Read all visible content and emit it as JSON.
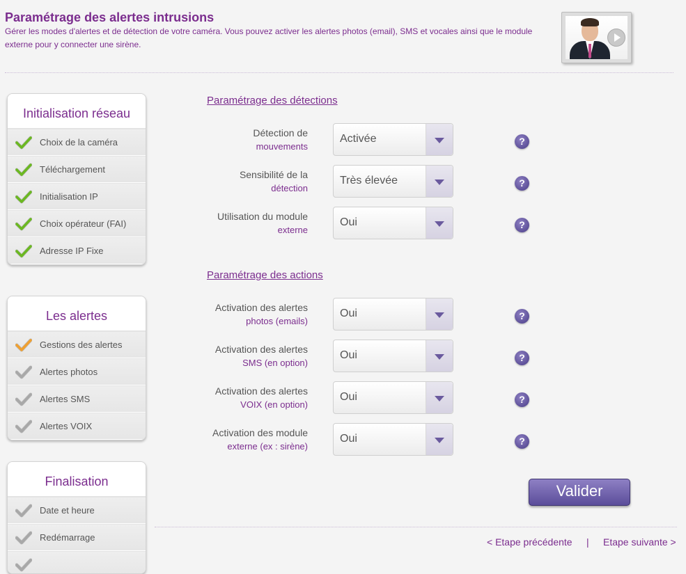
{
  "header": {
    "title": "Paramétrage des alertes intrusions",
    "description": "Gérer les modes d'alertes et de détection de votre caméra. Vous pouvez activer les alertes photos (email), SMS et vocales ainsi que le module externe pour y connecter une sirène."
  },
  "sidebar": {
    "panels": [
      {
        "title": "Initialisation réseau",
        "items": [
          {
            "label": "Choix de la caméra",
            "status": "done"
          },
          {
            "label": "Téléchargement",
            "status": "done"
          },
          {
            "label": "Initialisation IP",
            "status": "done"
          },
          {
            "label": "Choix opérateur (FAI)",
            "status": "done"
          },
          {
            "label": "Adresse IP Fixe",
            "status": "done"
          }
        ]
      },
      {
        "title": "Les alertes",
        "items": [
          {
            "label": "Gestions des alertes",
            "status": "current"
          },
          {
            "label": "Alertes photos",
            "status": "pending"
          },
          {
            "label": "Alertes SMS",
            "status": "pending"
          },
          {
            "label": "Alertes VOIX",
            "status": "pending"
          }
        ]
      },
      {
        "title": "Finalisation",
        "items": [
          {
            "label": "Date et heure",
            "status": "pending"
          },
          {
            "label": "Redémarrage",
            "status": "pending"
          }
        ]
      }
    ]
  },
  "detections": {
    "title": "Paramétrage des détections",
    "rows": [
      {
        "label1": "Détection de",
        "label2": "mouvements",
        "value": "Activée"
      },
      {
        "label1": "Sensibilité de la",
        "label2": "détection",
        "value": "Très élevée"
      },
      {
        "label1": "Utilisation du module",
        "label2": "externe",
        "value": "Oui"
      }
    ]
  },
  "actions": {
    "title": "Paramétrage des actions",
    "rows": [
      {
        "label1": "Activation des alertes",
        "label2": "photos (emails)",
        "value": "Oui"
      },
      {
        "label1": "Activation des alertes",
        "label2": "SMS (en option)",
        "value": "Oui"
      },
      {
        "label1": "Activation des alertes",
        "label2": "VOIX (en option)",
        "value": "Oui"
      },
      {
        "label1": "Activation des module",
        "label2": "externe (ex : sirène)",
        "value": "Oui"
      }
    ]
  },
  "help_symbol": "?",
  "validate_label": "Valider",
  "nav": {
    "prev": "< Etape précédente",
    "sep": "|",
    "next": "Etape suivante >"
  },
  "colors": {
    "accent": "#7b2d8e",
    "button": "#5b4d9a",
    "check_done": "#6bb821",
    "check_current": "#f0a030",
    "check_pending": "#a8a8a8"
  }
}
